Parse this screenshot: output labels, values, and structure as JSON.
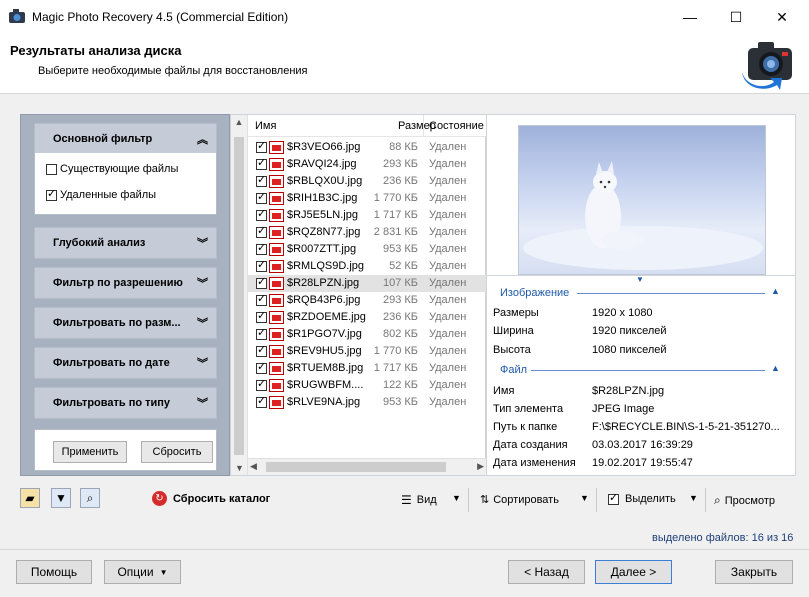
{
  "window": {
    "title": "Magic Photo Recovery 4.5 (Commercial Edition)",
    "minimize": "—",
    "maximize": "☐",
    "close": "✕"
  },
  "header": {
    "title": "Результаты анализа диска",
    "subtitle": "Выберите необходимые файлы для восстановления"
  },
  "filters": {
    "main": {
      "label": "Основной фильтр",
      "chevron": "︽"
    },
    "options": [
      {
        "label": "Существующие файлы",
        "checked": false
      },
      {
        "label": "Удаленные файлы",
        "checked": true
      }
    ],
    "groups": [
      {
        "label": "Глубокий анализ",
        "chevron": "︾"
      },
      {
        "label": "Фильтр по разрешению",
        "chevron": "︾"
      },
      {
        "label": "Фильтровать по разм...",
        "chevron": "︾"
      },
      {
        "label": "Фильтровать по дате",
        "chevron": "︾"
      },
      {
        "label": "Фильтровать по типу",
        "chevron": "︾"
      }
    ],
    "apply": "Применить",
    "reset": "Сбросить"
  },
  "file_list": {
    "columns": {
      "name": "Имя",
      "size": "Размер",
      "state": "Состояние"
    },
    "rows": [
      {
        "name": "$R3VEO66.jpg",
        "size": "88 КБ",
        "state": "Удален"
      },
      {
        "name": "$RAVQI24.jpg",
        "size": "293 КБ",
        "state": "Удален"
      },
      {
        "name": "$RBLQX0U.jpg",
        "size": "236 КБ",
        "state": "Удален"
      },
      {
        "name": "$RIH1B3C.jpg",
        "size": "1 770 КБ",
        "state": "Удален"
      },
      {
        "name": "$RJ5E5LN.jpg",
        "size": "1 717 КБ",
        "state": "Удален"
      },
      {
        "name": "$RQZ8N77.jpg",
        "size": "2 831 КБ",
        "state": "Удален"
      },
      {
        "name": "$R007ZTT.jpg",
        "size": "953 КБ",
        "state": "Удален"
      },
      {
        "name": "$RMLQS9D.jpg",
        "size": "52 КБ",
        "state": "Удален"
      },
      {
        "name": "$R28LPZN.jpg",
        "size": "107 КБ",
        "state": "Удален",
        "selected": true
      },
      {
        "name": "$RQB43P6.jpg",
        "size": "293 КБ",
        "state": "Удален"
      },
      {
        "name": "$RZDOEME.jpg",
        "size": "236 КБ",
        "state": "Удален"
      },
      {
        "name": "$R1PGO7V.jpg",
        "size": "802 КБ",
        "state": "Удален"
      },
      {
        "name": "$REV9HU5.jpg",
        "size": "1 770 КБ",
        "state": "Удален"
      },
      {
        "name": "$RTUEM8B.jpg",
        "size": "1 717 КБ",
        "state": "Удален"
      },
      {
        "name": "$RUGWBFM....",
        "size": "122 КБ",
        "state": "Удален"
      },
      {
        "name": "$RLVE9NA.jpg",
        "size": "953 КБ",
        "state": "Удален"
      }
    ]
  },
  "details": {
    "image_section": "Изображение",
    "image_props": [
      {
        "name": "Размеры",
        "value": "1920 x 1080"
      },
      {
        "name": "Ширина",
        "value": "1920 пикселей"
      },
      {
        "name": "Высота",
        "value": "1080 пикселей"
      }
    ],
    "file_section": "Файл",
    "file_props": [
      {
        "name": "Имя",
        "value": "$R28LPZN.jpg"
      },
      {
        "name": "Тип элемента",
        "value": "JPEG Image"
      },
      {
        "name": "Путь к папке",
        "value": "F:\\$RECYCLE.BIN\\S-1-5-21-351270..."
      },
      {
        "name": "Дата создания",
        "value": "03.03.2017 16:39:29"
      },
      {
        "name": "Дата изменения",
        "value": "19.02.2017 19:55:47"
      }
    ]
  },
  "toolbar": {
    "reset_catalog": "Сбросить каталог",
    "view": "Вид",
    "sort": "Сортировать",
    "select": "Выделить",
    "preview": "Просмотр"
  },
  "status": {
    "selected_files": "выделено файлов: 16 из 16"
  },
  "buttons": {
    "help": "Помощь",
    "options": "Опции",
    "back": "< Назад",
    "next": "Далее >",
    "close": "Закрыть"
  }
}
